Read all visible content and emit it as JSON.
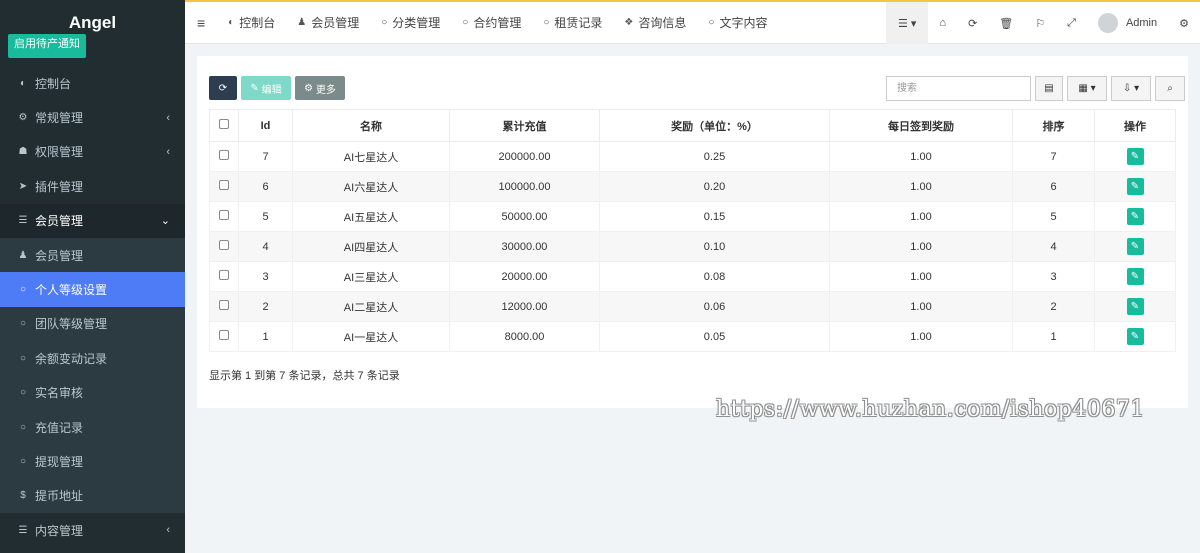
{
  "brand": {
    "name": "Angel",
    "notice_label": "启用待产通知"
  },
  "sidebar": {
    "items": [
      {
        "label": "控制台",
        "icon": "dashboard-icon",
        "glyph": "◐",
        "state": "normal",
        "arrow": ""
      },
      {
        "label": "常规管理",
        "icon": "cogs-icon",
        "glyph": "⚙",
        "state": "normal",
        "arrow": "‹"
      },
      {
        "label": "权限管理",
        "icon": "users-icon",
        "glyph": "☗",
        "state": "normal",
        "arrow": "‹"
      },
      {
        "label": "插件管理",
        "icon": "rocket-icon",
        "glyph": "➤",
        "state": "normal",
        "arrow": ""
      },
      {
        "label": "会员管理",
        "icon": "list-icon",
        "glyph": "☰",
        "state": "open",
        "arrow": "⌄"
      },
      {
        "label": "会员管理",
        "icon": "user-icon",
        "glyph": "♟",
        "state": "sub",
        "arrow": ""
      },
      {
        "label": "个人等级设置",
        "icon": "circle-icon",
        "glyph": "○",
        "state": "active",
        "arrow": ""
      },
      {
        "label": "团队等级管理",
        "icon": "circle-icon",
        "glyph": "○",
        "state": "sub",
        "arrow": ""
      },
      {
        "label": "余额变动记录",
        "icon": "circle-icon",
        "glyph": "○",
        "state": "sub",
        "arrow": ""
      },
      {
        "label": "实名审核",
        "icon": "circle-icon",
        "glyph": "○",
        "state": "sub",
        "arrow": ""
      },
      {
        "label": "充值记录",
        "icon": "circle-icon",
        "glyph": "○",
        "state": "sub",
        "arrow": ""
      },
      {
        "label": "提现管理",
        "icon": "circle-icon",
        "glyph": "○",
        "state": "sub",
        "arrow": ""
      },
      {
        "label": "提币地址",
        "icon": "dollar-icon",
        "glyph": "$",
        "state": "sub",
        "arrow": ""
      },
      {
        "label": "内容管理",
        "icon": "list-icon",
        "glyph": "☰",
        "state": "normal",
        "arrow": "‹"
      }
    ]
  },
  "topnav": {
    "tabs": [
      {
        "label": "控制台",
        "icon": "dashboard-icon",
        "glyph": "◐"
      },
      {
        "label": "会员管理",
        "icon": "user-icon",
        "glyph": "♟"
      },
      {
        "label": "分类管理",
        "icon": "circle-icon",
        "glyph": "○"
      },
      {
        "label": "合约管理",
        "icon": "circle-icon",
        "glyph": "○"
      },
      {
        "label": "租赁记录",
        "icon": "circle-icon",
        "glyph": "○"
      },
      {
        "label": "咨询信息",
        "icon": "comments-icon",
        "glyph": "❖"
      },
      {
        "label": "文字内容",
        "icon": "circle-icon",
        "glyph": "○"
      }
    ],
    "admin_label": "Admin"
  },
  "toolbar": {
    "edit_label": "编辑",
    "more_label": "更多",
    "search_placeholder": "搜索"
  },
  "table": {
    "headers": [
      "Id",
      "名称",
      "累计充值",
      "奖励（单位：%）",
      "每日签到奖励",
      "排序",
      "操作"
    ],
    "rows": [
      {
        "id": "7",
        "name": "AI七星达人",
        "recharge": "200000.00",
        "reward": "0.25",
        "daily": "1.00",
        "sort": "7"
      },
      {
        "id": "6",
        "name": "AI六星达人",
        "recharge": "100000.00",
        "reward": "0.20",
        "daily": "1.00",
        "sort": "6"
      },
      {
        "id": "5",
        "name": "AI五星达人",
        "recharge": "50000.00",
        "reward": "0.15",
        "daily": "1.00",
        "sort": "5"
      },
      {
        "id": "4",
        "name": "AI四星达人",
        "recharge": "30000.00",
        "reward": "0.10",
        "daily": "1.00",
        "sort": "4"
      },
      {
        "id": "3",
        "name": "AI三星达人",
        "recharge": "20000.00",
        "reward": "0.08",
        "daily": "1.00",
        "sort": "3"
      },
      {
        "id": "2",
        "name": "AI二星达人",
        "recharge": "12000.00",
        "reward": "0.06",
        "daily": "1.00",
        "sort": "2"
      },
      {
        "id": "1",
        "name": "AI一星达人",
        "recharge": "8000.00",
        "reward": "0.05",
        "daily": "1.00",
        "sort": "1"
      }
    ]
  },
  "pagination": {
    "info": "显示第 1 到第 7 条记录，总共 7 条记录"
  },
  "watermark": "https://www.huzhan.com/ishop40671",
  "colors": {
    "sidebar_bg": "#222d32",
    "active": "#4e7cf7",
    "success": "#18bc9c",
    "primary_dark": "#2c3e50"
  }
}
